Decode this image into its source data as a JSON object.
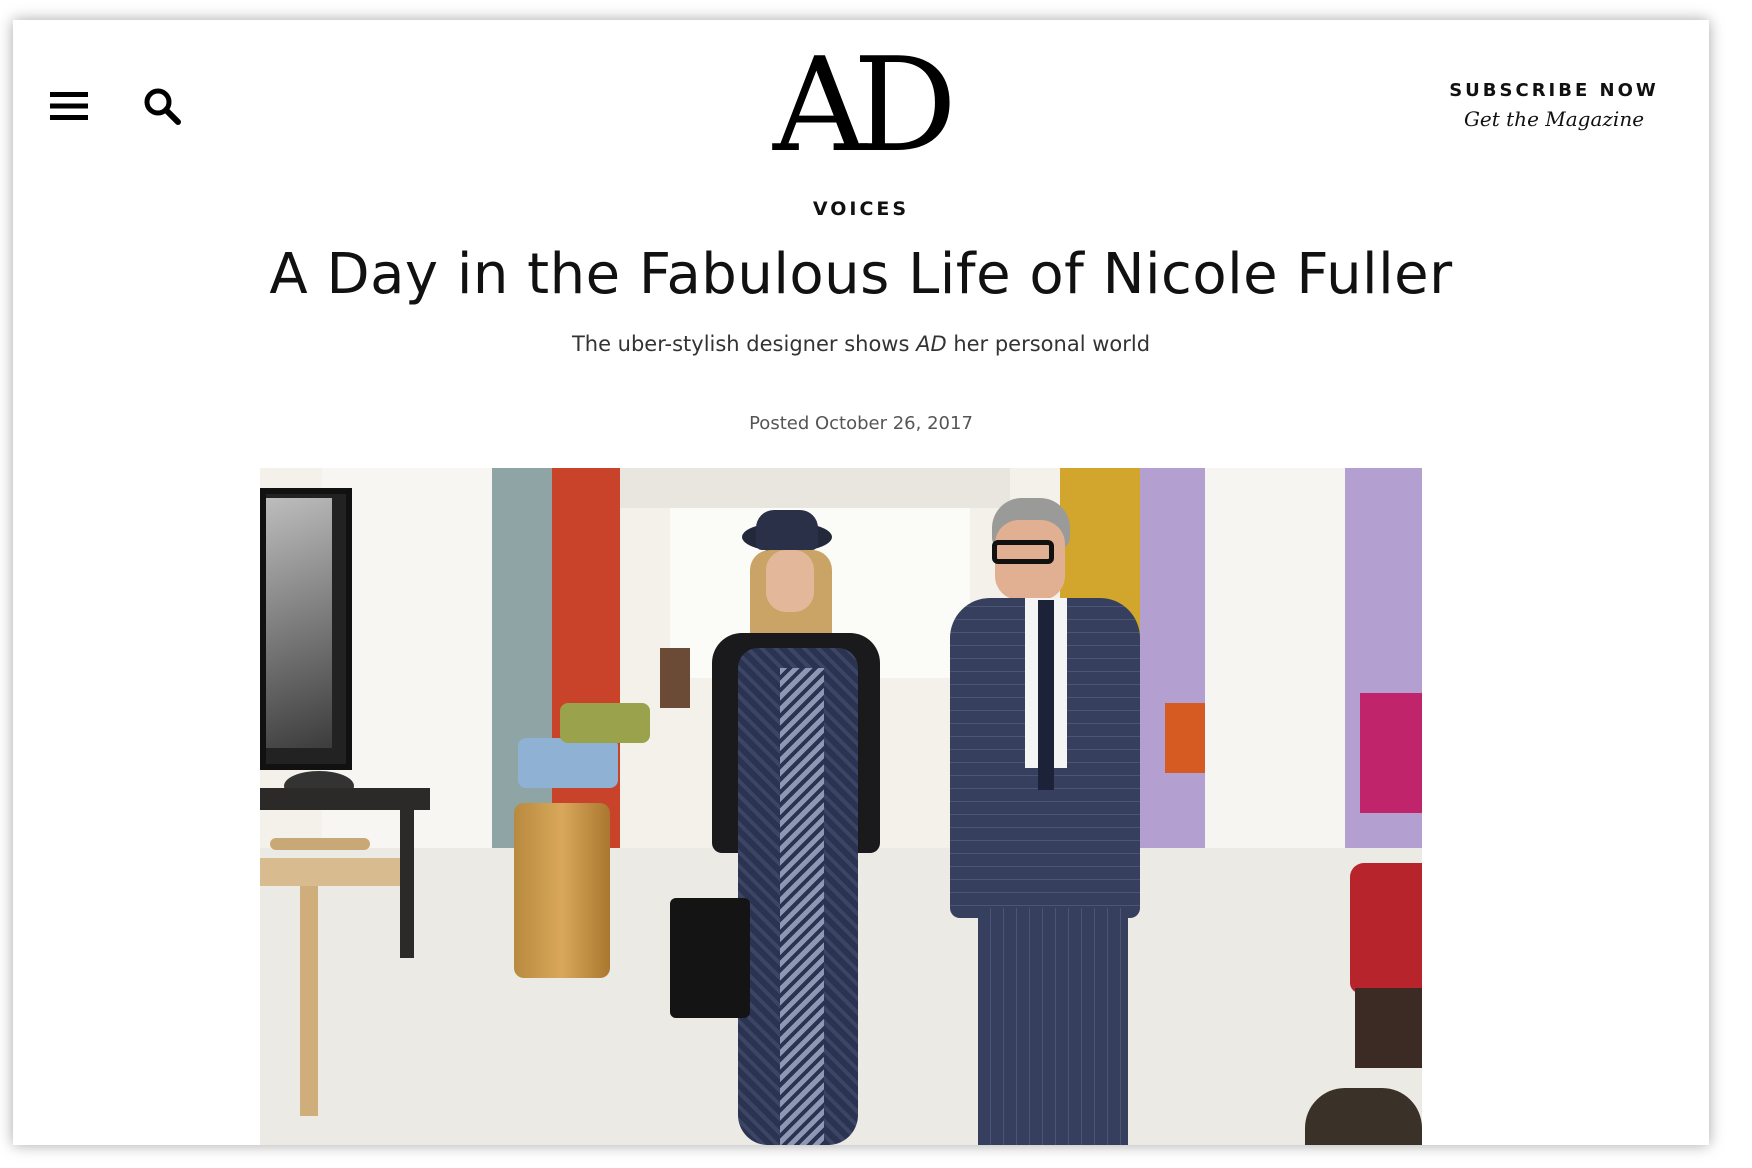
{
  "header": {
    "menu_icon": "hamburger-menu-icon",
    "search_icon": "search-icon",
    "logo_text": "AD",
    "subscribe_label": "SUBSCRIBE NOW",
    "magazine_label": "Get the Magazine"
  },
  "article": {
    "rubric": "VOICES",
    "headline": "A Day in the Fabulous Life of Nicole Fuller",
    "dek_before": "The uber-stylish designer shows ",
    "dek_italic": "AD",
    "dek_after": " her personal world",
    "posted": "Posted October 26, 2017"
  },
  "hero_image": {
    "subject": "two-people-walking-in-furniture-gallery",
    "colors": {
      "wall_red": "#c9432a",
      "wall_teal": "#8fa4a4",
      "wall_mustard": "#d2a52c",
      "wall_lavender": "#b3a0d0",
      "floor": "#eceae4",
      "dress_navy": "#2a3350",
      "suit_check": "#36405e"
    }
  }
}
